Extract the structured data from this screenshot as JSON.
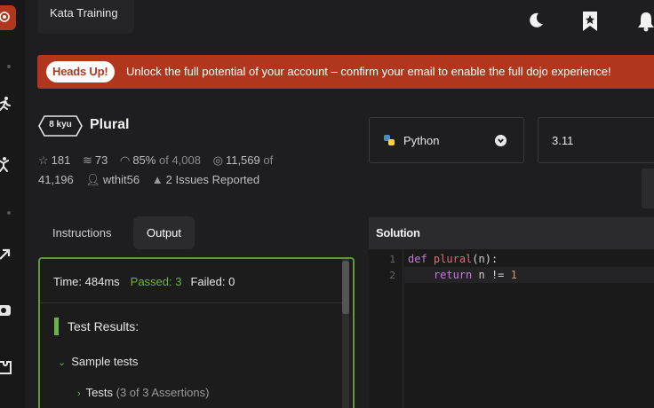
{
  "header": {
    "tab_label": "Kata Training"
  },
  "banner": {
    "badge": "Heads Up!",
    "message": "Unlock the full potential of your account – confirm your email to enable the full dojo experience!",
    "color": "#b1361e"
  },
  "kata": {
    "rank": "8 kyu",
    "title": "Plural",
    "stars": "181",
    "collections": "73",
    "satisfaction": "85%",
    "satisfaction_of": "of 4,008",
    "completed": "11,569",
    "completed_of": "of",
    "completed_total": "41,196",
    "author": "wthit56",
    "issues": "2 Issues Reported"
  },
  "language": {
    "name": "Python",
    "version": "3.11"
  },
  "tabs": {
    "instructions": "Instructions",
    "output": "Output"
  },
  "output": {
    "time": "Time: 484ms",
    "passed": "Passed: 3",
    "failed": "Failed: 0",
    "results_label": "Test Results:",
    "group": "Sample tests",
    "sub_group": "Tests",
    "assertions": "(3 of 3 Assertions)",
    "accent_color": "#6bb343"
  },
  "solution": {
    "header": "Solution",
    "line_numbers": [
      "1",
      "2"
    ],
    "code": {
      "l1_kw": "def",
      "l1_fn": "plural",
      "l1_rest": "(n):",
      "l2_indent": "    ",
      "l2_kw": "return",
      "l2_mid": " n != ",
      "l2_num": "1"
    }
  },
  "icons": {
    "sidebar": [
      "codewars-logo-icon",
      "running-person-icon",
      "martial-arts-icon",
      "external-link-icon",
      "chat-icon",
      "puzzle-icon"
    ],
    "top": [
      "moon-icon",
      "bookmark-star-icon",
      "bell-icon"
    ]
  }
}
